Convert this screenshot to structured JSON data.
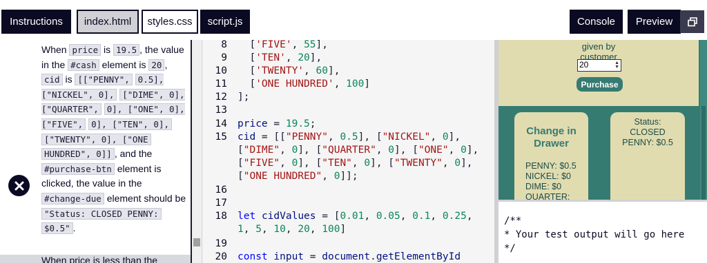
{
  "tabs": {
    "instructions": "Instructions",
    "index": "index.html",
    "styles": "styles.css",
    "script": "script.js",
    "console": "Console",
    "preview": "Preview"
  },
  "test": {
    "w1": "When",
    "c_price": "price",
    "w2": "is",
    "c_195": "19.5",
    "w3": ", the value in the",
    "c_cash": "#cash",
    "w4": "element is",
    "c_20": "20",
    "w5": ",",
    "c_cid": "cid",
    "w6": "is",
    "c_cidval_1": "[[\"PENNY\",",
    "c_cidval_2": "0.5], [\"NICKEL\", 0],",
    "c_cidval_3": "[\"DIME\", 0], [\"QUARTER\",",
    "c_cidval_4": "0], [\"ONE\", 0], [\"FIVE\",",
    "c_cidval_5": "0], [\"TEN\", 0],",
    "c_cidval_6": "[\"TWENTY\", 0], [\"ONE",
    "c_cidval_7": "HUNDRED\", 0]]",
    "w7": ", and the",
    "c_btn": "#purchase-btn",
    "w8": "element is clicked, the value in the",
    "c_change": "#change-due",
    "w9": "element should be",
    "c_status_1": "\"Status: CLOSED PENNY:",
    "c_status_2": "$0.5\"",
    "w10": ".",
    "next": "When price is less than the"
  },
  "code_lines": [
    {
      "n": "8",
      "parts": [
        [
          "p",
          "  ["
        ],
        [
          "s",
          "'FIVE'"
        ],
        [
          "p",
          ", "
        ],
        [
          "n",
          "55"
        ],
        [
          "p",
          "],"
        ]
      ]
    },
    {
      "n": "9",
      "parts": [
        [
          "p",
          "  ["
        ],
        [
          "s",
          "'TEN'"
        ],
        [
          "p",
          ", "
        ],
        [
          "n",
          "20"
        ],
        [
          "p",
          "],"
        ]
      ]
    },
    {
      "n": "10",
      "parts": [
        [
          "p",
          "  ["
        ],
        [
          "s",
          "'TWENTY'"
        ],
        [
          "p",
          ", "
        ],
        [
          "n",
          "60"
        ],
        [
          "p",
          "],"
        ]
      ]
    },
    {
      "n": "11",
      "parts": [
        [
          "p",
          "  ["
        ],
        [
          "s",
          "'ONE HUNDRED'"
        ],
        [
          "p",
          ", "
        ],
        [
          "n",
          "100"
        ],
        [
          "p",
          "]"
        ]
      ]
    },
    {
      "n": "12",
      "parts": [
        [
          "p",
          "];"
        ]
      ]
    },
    {
      "n": "13",
      "parts": []
    },
    {
      "n": "14",
      "parts": [
        [
          "v",
          "price"
        ],
        [
          "p",
          " = "
        ],
        [
          "n",
          "19.5"
        ],
        [
          "p",
          ";"
        ]
      ]
    },
    {
      "n": "15",
      "parts": [
        [
          "v",
          "cid"
        ],
        [
          "p",
          " = [["
        ],
        [
          "s",
          "\"PENNY\""
        ],
        [
          "p",
          ", "
        ],
        [
          "n",
          "0.5"
        ],
        [
          "p",
          "], ["
        ],
        [
          "s",
          "\"NICKEL\""
        ],
        [
          "p",
          ", "
        ],
        [
          "n",
          "0"
        ],
        [
          "p",
          "],"
        ]
      ]
    },
    {
      "n": "",
      "parts": [
        [
          "p",
          "["
        ],
        [
          "s",
          "\"DIME\""
        ],
        [
          "p",
          ", "
        ],
        [
          "n",
          "0"
        ],
        [
          "p",
          "], ["
        ],
        [
          "s",
          "\"QUARTER\""
        ],
        [
          "p",
          ", "
        ],
        [
          "n",
          "0"
        ],
        [
          "p",
          "], ["
        ],
        [
          "s",
          "\"ONE\""
        ],
        [
          "p",
          ", "
        ],
        [
          "n",
          "0"
        ],
        [
          "p",
          "],"
        ]
      ]
    },
    {
      "n": "",
      "parts": [
        [
          "p",
          "["
        ],
        [
          "s",
          "\"FIVE\""
        ],
        [
          "p",
          ", "
        ],
        [
          "n",
          "0"
        ],
        [
          "p",
          "], ["
        ],
        [
          "s",
          "\"TEN\""
        ],
        [
          "p",
          ", "
        ],
        [
          "n",
          "0"
        ],
        [
          "p",
          "], ["
        ],
        [
          "s",
          "\"TWENTY\""
        ],
        [
          "p",
          ", "
        ],
        [
          "n",
          "0"
        ],
        [
          "p",
          "],"
        ]
      ]
    },
    {
      "n": "",
      "parts": [
        [
          "p",
          "["
        ],
        [
          "s",
          "\"ONE HUNDRED\""
        ],
        [
          "p",
          ", "
        ],
        [
          "n",
          "0"
        ],
        [
          "p",
          "]];"
        ]
      ]
    },
    {
      "n": "16",
      "parts": []
    },
    {
      "n": "17",
      "parts": []
    },
    {
      "n": "18",
      "parts": [
        [
          "k",
          "let"
        ],
        [
          "p",
          " "
        ],
        [
          "v",
          "cidValues"
        ],
        [
          "p",
          " = ["
        ],
        [
          "n",
          "0.01"
        ],
        [
          "p",
          ", "
        ],
        [
          "n",
          "0.05"
        ],
        [
          "p",
          ", "
        ],
        [
          "n",
          "0.1"
        ],
        [
          "p",
          ", "
        ],
        [
          "n",
          "0.25"
        ],
        [
          "p",
          ","
        ]
      ]
    },
    {
      "n": "",
      "parts": [
        [
          "n",
          "1"
        ],
        [
          "p",
          ", "
        ],
        [
          "n",
          "5"
        ],
        [
          "p",
          ", "
        ],
        [
          "n",
          "10"
        ],
        [
          "p",
          ", "
        ],
        [
          "n",
          "20"
        ],
        [
          "p",
          ", "
        ],
        [
          "n",
          "100"
        ],
        [
          "p",
          "]"
        ]
      ]
    },
    {
      "n": "19",
      "parts": []
    },
    {
      "n": "20",
      "parts": [
        [
          "k",
          "const"
        ],
        [
          "p",
          " "
        ],
        [
          "v",
          "input"
        ],
        [
          "p",
          " = "
        ],
        [
          "v",
          "document"
        ],
        [
          "p",
          "."
        ],
        [
          "v",
          "getElementById"
        ]
      ]
    }
  ],
  "preview": {
    "given_line1": "given by",
    "given_line2": "customer",
    "cash_value": "20",
    "purchase": "Purchase",
    "drawer_title_1": "Change in",
    "drawer_title_2": "Drawer",
    "drawer_items": [
      "PENNY: $0.5",
      "NICKEL: $0",
      "DIME: $0",
      "QUARTER:"
    ],
    "status_1": "Status:",
    "status_2": "CLOSED",
    "status_3": "PENNY: $0.5"
  },
  "console": {
    "l1": "/**",
    "l2": "* Your test output will go here",
    "l3": "*/"
  },
  "colors": {
    "accent_dark": "#0a0a23",
    "preview_bg": "#367b72",
    "card_bg": "#e0dcb0"
  }
}
